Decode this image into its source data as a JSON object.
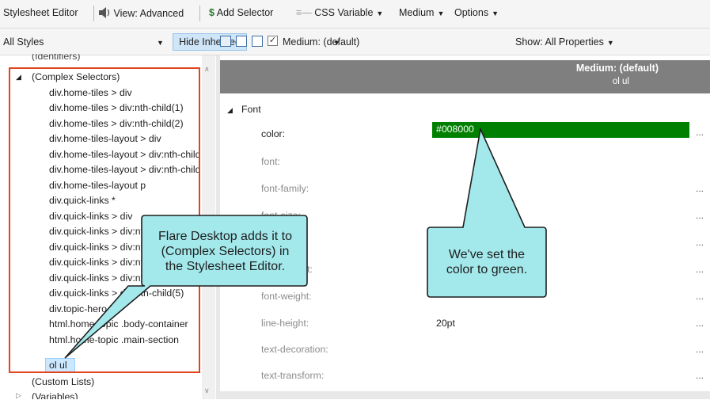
{
  "toolbar": {
    "app_title": "Stylesheet Editor",
    "view_label": "View: Advanced",
    "add_selector_label": "Add Selector",
    "css_variable_label": "CSS Variable",
    "medium_label": "Medium",
    "options_label": "Options"
  },
  "toolbar2": {
    "styles_dropdown": "All Styles",
    "hide_inherited": "Hide Inherited",
    "medium_checkbox_label": "Medium: (default)",
    "show_dropdown": "Show: All Properties"
  },
  "tree": {
    "cut_top_item": "(Identifiers)",
    "group_label": "(Complex Selectors)",
    "items": [
      "div.home-tiles > div",
      "div.home-tiles > div:nth-child(1)",
      "div.home-tiles > div:nth-child(2)",
      "div.home-tiles-layout > div",
      "div.home-tiles-layout > div:nth-child",
      "div.home-tiles-layout > div:nth-child",
      "div.home-tiles-layout p",
      "div.quick-links *",
      "div.quick-links > div",
      "div.quick-links > div:nth-child",
      "div.quick-links > div:nth-child",
      "div.quick-links > div:nth-child",
      "div.quick-links > div:nth-child",
      "div.quick-links > div:nth-child(5)",
      "div.topic-hero h1",
      "html.home-topic .body-container",
      "html.home-topic .main-section",
      "ol ul"
    ],
    "custom_lists": "(Custom Lists)",
    "variables": "(Variables)"
  },
  "panel_header": {
    "title": "Medium: (default)",
    "selector": "ol ul"
  },
  "properties": {
    "group_label": "Font",
    "rows": [
      {
        "label": "color",
        "value": "#008000"
      },
      {
        "label": "font",
        "value": ""
      },
      {
        "label": "font-family",
        "value": ""
      },
      {
        "label": "font-size",
        "value": ""
      },
      {
        "label": "font-style",
        "value": ""
      },
      {
        "label": "font-variant",
        "value": ""
      },
      {
        "label": "font-weight",
        "value": ""
      },
      {
        "label": "line-height",
        "value": "20pt"
      },
      {
        "label": "text-decoration",
        "value": ""
      },
      {
        "label": "text-transform",
        "value": ""
      }
    ],
    "color_swatch": "#008000"
  },
  "callouts": {
    "left_line1": "Flare Desktop adds it to",
    "left_line2": "(Complex Selectors) in",
    "left_line3": "the Stylesheet Editor.",
    "right_line1": "We've set the",
    "right_line2": "color to green."
  },
  "colors": {
    "callout_fill": "#a3e9ec",
    "highlight_border": "#e0441c",
    "header_bg": "#7f7f7f",
    "selection_bg": "#cce8ff"
  }
}
